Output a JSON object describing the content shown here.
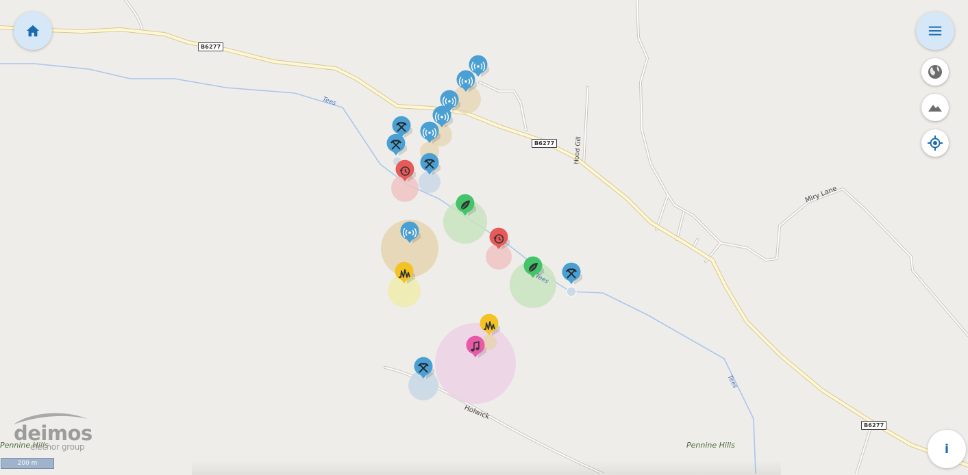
{
  "map": {
    "road_shields": [
      "B6277",
      "B6277",
      "B6277"
    ],
    "labels": {
      "river_1": "Tees",
      "river_2": "Tees",
      "river_3": "Tees",
      "hood_gill": "Hood Gill",
      "miry_lane": "Miry Lane",
      "holwick": "Holwick",
      "pennine_1": "Pennine Hills",
      "pennine_2": "Pennine Hills"
    },
    "marker_colors": {
      "antenna": "#4a9fd3",
      "mining": "#4a9fd3",
      "history": "#e85a5a",
      "nature": "#43c46a",
      "geology": "#f3c323",
      "music": "#e85aa8"
    }
  },
  "controls": {
    "home_icon": "home-icon",
    "menu_icon": "menu-icon",
    "globe_icon": "globe-icon",
    "terrain_icon": "mountain-icon",
    "locate_icon": "locate-icon",
    "info_label": "i"
  },
  "logo": {
    "name": "deimos",
    "sub": "elecnor group"
  },
  "scale": {
    "label": "200 m"
  }
}
